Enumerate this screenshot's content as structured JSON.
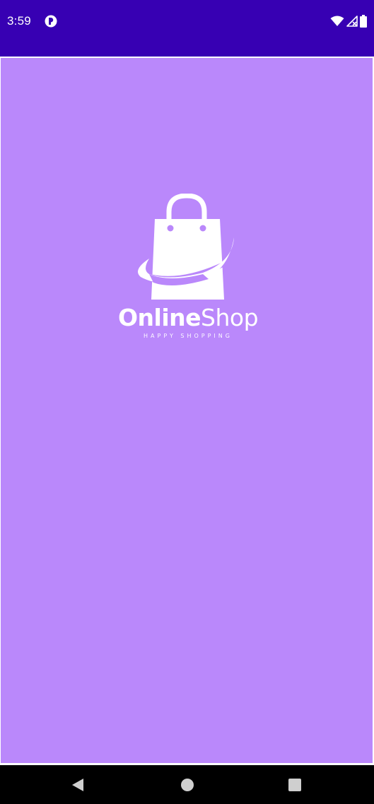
{
  "status_bar": {
    "time": "3:59",
    "background": "#3700b3",
    "icons": [
      "app-notification-icon",
      "wifi-icon",
      "signal-icon",
      "battery-icon"
    ]
  },
  "splash": {
    "background": "#ba88fb",
    "logo_icon": "shopping-bag-icon",
    "brand_name_part1": "Online",
    "brand_name_part2": "Shop",
    "tagline": "HAPPY SHOPPING"
  },
  "nav_bar": {
    "background": "#000000",
    "buttons": [
      "back-icon",
      "home-icon",
      "recents-icon"
    ]
  }
}
